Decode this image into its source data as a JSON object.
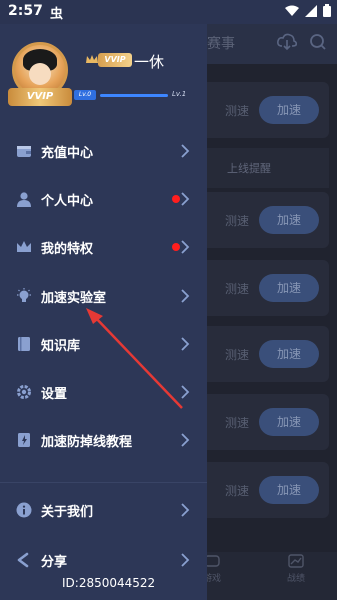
{
  "statusbar": {
    "time": "2:57",
    "bug": "虫"
  },
  "background_app": {
    "title": "赛事",
    "speed_label": "测速",
    "accel_label": "加速",
    "remind_label": "上线提醒",
    "tabs": [
      "游戏",
      "战绩"
    ]
  },
  "profile": {
    "vvip_badge": "VVIP",
    "vvip_tag": "VVIP",
    "username": "一休",
    "level_current": "Lv.0",
    "level_next": "Lv.1",
    "level_progress": 1.0
  },
  "menu": [
    {
      "label": "充值中心",
      "icon": "wallet-icon",
      "dot": false
    },
    {
      "label": "个人中心",
      "icon": "person-icon",
      "dot": true
    },
    {
      "label": "我的特权",
      "icon": "crown-icon",
      "dot": true
    },
    {
      "label": "加速实验室",
      "icon": "lightbulb-icon",
      "dot": false
    },
    {
      "label": "知识库",
      "icon": "book-icon",
      "dot": false
    },
    {
      "label": "设置",
      "icon": "gear-icon",
      "dot": false
    },
    {
      "label": "加速防掉线教程",
      "icon": "tutorial-book-icon",
      "dot": false
    }
  ],
  "bottom_menu": [
    {
      "label": "关于我们",
      "icon": "info-icon"
    },
    {
      "label": "分享",
      "icon": "share-icon"
    }
  ],
  "user_id": "ID:2850044522",
  "colors": {
    "drawer_bg": "#2d3757",
    "accent": "#3d86ff",
    "dot": "#ff1e1e",
    "arrow": "#e53935"
  }
}
